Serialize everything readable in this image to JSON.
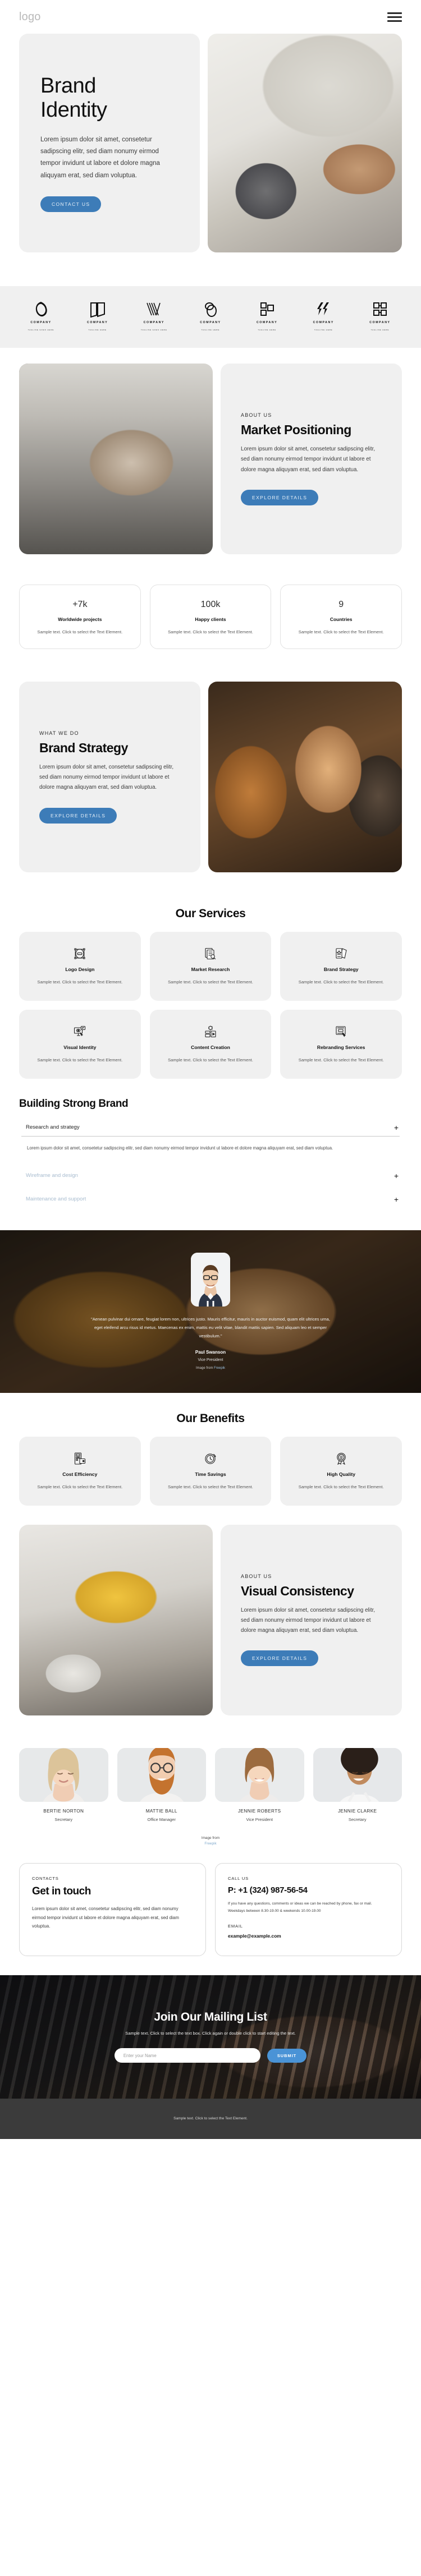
{
  "header": {
    "logo": "logo",
    "menu_icon": "hamburger-menu-icon"
  },
  "hero": {
    "title_line1": "Brand",
    "title_line2": "Identity",
    "paragraph": "Lorem ipsum dolor sit amet, consetetur sadipscing elitr, sed diam nonumy eirmod tempor invidunt ut labore et dolore magna aliquyam erat, sed diam voluptua.",
    "cta": "CONTACT US"
  },
  "logos": [
    {
      "name": "COMPANY",
      "tagline": "TAGLINE GOES HERE"
    },
    {
      "name": "COMPANY",
      "tagline": "TAGLINE HERE"
    },
    {
      "name": "COMPANY",
      "tagline": "TAGLINE GOES HERE"
    },
    {
      "name": "COMPANY",
      "tagline": "TAGLINE HERE"
    },
    {
      "name": "COMPANY",
      "tagline": "TAGLINE HERE"
    },
    {
      "name": "COMPANY",
      "tagline": "TAGLINE HERE"
    },
    {
      "name": "COMPANY",
      "tagline": "TAGLINE HERE"
    }
  ],
  "market": {
    "eyebrow": "ABOUT US",
    "heading": "Market Positioning",
    "paragraph": "Lorem ipsum dolor sit amet, consetetur sadipscing elitr, sed diam nonumy eirmod tempor invidunt ut labore et dolore magna aliquyam erat, sed diam voluptua.",
    "cta": "EXPLORE DETAILS"
  },
  "stats": [
    {
      "number": "+7k",
      "label": "Worldwide projects",
      "text": "Sample text. Click to select the Text Element."
    },
    {
      "number": "100k",
      "label": "Happy clients",
      "text": "Sample text. Click to select the Text Element."
    },
    {
      "number": "9",
      "label": "Countries",
      "text": "Sample text. Click to select the Text Element."
    }
  ],
  "strategy": {
    "eyebrow": "WHAT WE DO",
    "heading": "Brand Strategy",
    "paragraph": "Lorem ipsum dolor sit amet, consetetur sadipscing elitr, sed diam nonumy eirmod tempor invidunt ut labore et dolore magna aliquyam erat, sed diam voluptua.",
    "cta": "EXPLORE DETAILS"
  },
  "services": {
    "title": "Our Services",
    "items": [
      {
        "icon": "logo-design-icon",
        "title": "Logo Design",
        "text": "Sample text. Click to select the Text Element."
      },
      {
        "icon": "market-research-icon",
        "title": "Market Research",
        "text": "Sample text. Click to select the Text Element."
      },
      {
        "icon": "brand-strategy-icon",
        "title": "Brand Strategy",
        "text": "Sample text. Click to select the Text Element."
      },
      {
        "icon": "visual-identity-icon",
        "title": "Visual Identity",
        "text": "Sample text. Click to select the Text Element."
      },
      {
        "icon": "content-creation-icon",
        "title": "Content Creation",
        "text": "Sample text. Click to select the Text Element."
      },
      {
        "icon": "rebranding-icon",
        "title": "Rebranding Services",
        "text": "Sample text. Click to select the Text Element."
      }
    ]
  },
  "accordion": {
    "title": "Building Strong Brand",
    "items": [
      {
        "label": "Research and strategy",
        "toggle": "+",
        "open": true,
        "body": "Lorem ipsum dolor sit amet, consetetur sadipscing elitr, sed diam nonumy eirmod tempor invidunt ut labore et dolore magna aliquyam erat, sed diam voluptua."
      },
      {
        "label": "Wireframe and design",
        "toggle": "+",
        "open": false,
        "body": ""
      },
      {
        "label": "Maintenance and support",
        "toggle": "+",
        "open": false,
        "body": ""
      }
    ]
  },
  "testimonial": {
    "quote": "\"Aenean pulvinar dui ornare, feugiat lorem non, ultrices justo. Mauris efficitur, mauris in auctor euismod, quam elit ultrices urna, eget eleifend arcu risus id metus. Maecenas ex enim, mattis eu velit vitae, blandit mattis sapien. Sed aliquam leo et semper vestibulum.\"",
    "name": "Paul Swanson",
    "role": "Vice President",
    "credit_prefix": "Image from",
    "credit_link": "Freepik"
  },
  "benefits": {
    "title": "Our Benefits",
    "items": [
      {
        "icon": "cost-efficiency-icon",
        "title": "Cost Efficiency",
        "text": "Sample text. Click to select the Text Element."
      },
      {
        "icon": "time-savings-icon",
        "title": "Time Savings",
        "text": "Sample text. Click to select the Text Element."
      },
      {
        "icon": "high-quality-icon",
        "title": "High Quality",
        "text": "Sample text. Click to select the Text Element."
      }
    ]
  },
  "visual": {
    "eyebrow": "ABOUT US",
    "heading": "Visual Consistency",
    "paragraph": "Lorem ipsum dolor sit amet, consetetur sadipscing elitr, sed diam nonumy eirmod tempor invidunt ut labore et dolore magna aliquyam erat, sed diam voluptua.",
    "cta": "EXPLORE DETAILS"
  },
  "team": {
    "members": [
      {
        "name": "BERTIE NORTON",
        "role": "Secretary"
      },
      {
        "name": "MATTIE BALL",
        "role": "Office Manager"
      },
      {
        "name": "JENNIE ROBERTS",
        "role": "Vice President"
      },
      {
        "name": "JENNIE CLARKE",
        "role": "Secretary"
      }
    ],
    "credit_prefix": "Image from",
    "credit_link": "Freepik"
  },
  "contact": {
    "left": {
      "label": "CONTACTS",
      "heading": "Get in touch",
      "paragraph": "Lorem ipsum dolor sit amet, consetetur sadipscing elitr, sed diam nonumy eirmod tempor invidunt ut labore et dolore magna aliquyam erat, sed diam voluptua."
    },
    "right": {
      "label": "CALL US",
      "phone": "P: +1 (324) 987-56-54",
      "hours": "If you have any questions, comments or ideas we can be reached by phone, fax or mail. Weekdays between 8.30-19.00 & weekends 10.00-19.00",
      "email_label": "EMAIL",
      "email": "example@example.com"
    }
  },
  "mailing": {
    "heading": "Join Our Mailing List",
    "sub": "Sample text. Click to select the text box. Click again or double click to start editing the text.",
    "input_placeholder": "Enter your Name",
    "input_value": "",
    "submit": "SUBMIT"
  },
  "footer": {
    "text": "Sample text. Click to select the Text Element."
  },
  "colors": {
    "accent": "#3d7cb8",
    "accent_light": "#4a93d6",
    "panel": "#f0f0f0",
    "footer_bg": "#3b3b3b"
  }
}
